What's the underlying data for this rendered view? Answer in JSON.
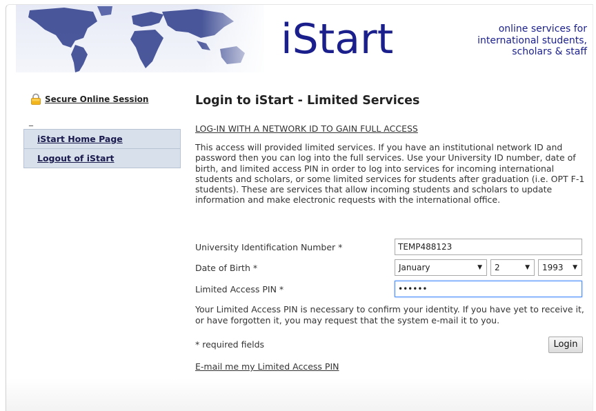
{
  "header": {
    "logo_text": "iStart",
    "tagline_line1": "online services for",
    "tagline_line2": "international students,",
    "tagline_line3": "scholars & staff"
  },
  "sidebar": {
    "secure_label": "Secure Online Session",
    "dash": "_",
    "items": [
      {
        "label": "iStart Home Page"
      },
      {
        "label": "Logout of iStart"
      }
    ]
  },
  "main": {
    "title": "Login to iStart - Limited Services",
    "full_access_link": "LOG-IN WITH A NETWORK ID TO GAIN FULL ACCESS",
    "intro": "This access will provided limited services. If you have an institutional network ID and password then you can log into the full services. Use your University ID number, date of birth, and limited access PIN in order to log into services for incoming international students and scholars, or some limited services for students after graduation (i.e. OPT F-1 students). These are services that allow incoming students and scholars to update information and make electronic requests with the international office.",
    "form": {
      "uid_label": "University Identification Number *",
      "uid_value": "TEMP488123",
      "dob_label": "Date of Birth *",
      "dob_month": "January",
      "dob_day": "2",
      "dob_year": "1993",
      "pin_label": "Limited Access PIN *",
      "pin_value": "••••••"
    },
    "help_text": "Your Limited Access PIN is necessary to confirm your identity. If you have yet to receive it, or have forgotten it, you may request that the system e-mail it to you.",
    "required_note": "* required fields",
    "login_button": "Login",
    "email_pin_link": "E-mail me my Limited Access PIN"
  },
  "colors": {
    "brand": "#1a1f8c",
    "nav_bg": "#d8e0ec",
    "nav_border": "#b7c3d3"
  }
}
